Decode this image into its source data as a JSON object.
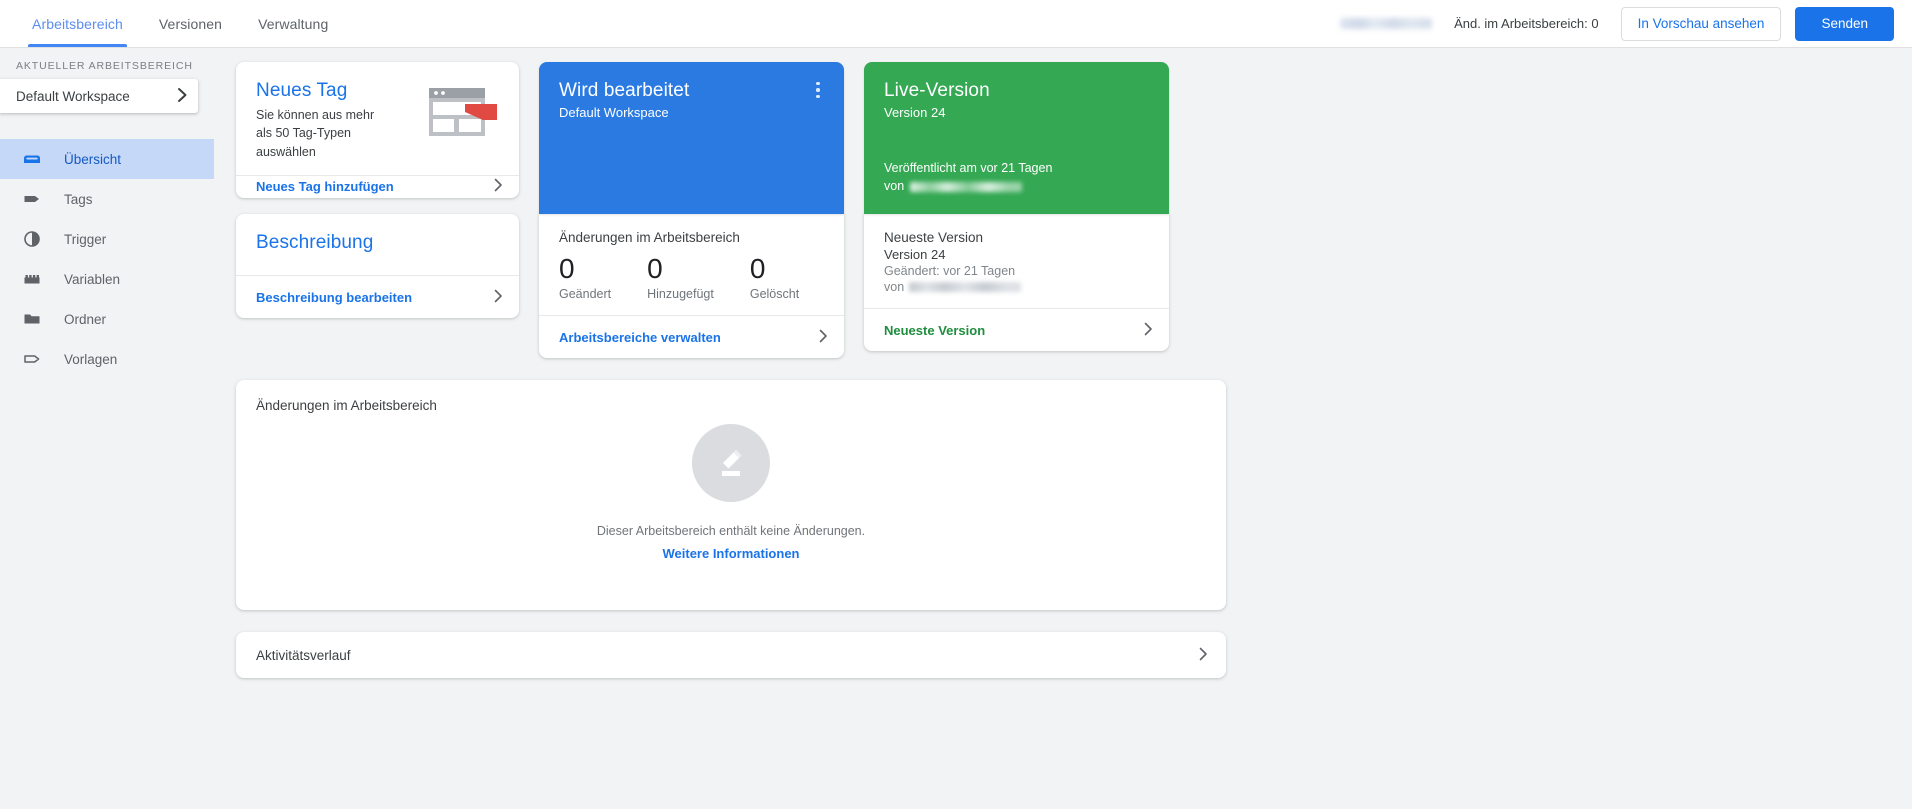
{
  "header": {
    "tabs": [
      {
        "label": "Arbeitsbereich",
        "active": true
      },
      {
        "label": "Versionen",
        "active": false
      },
      {
        "label": "Verwaltung",
        "active": false
      }
    ],
    "account_id_redacted": "",
    "changes_count_label": "Änd. im Arbeitsbereich: 0",
    "preview_button": "In Vorschau ansehen",
    "submit_button": "Senden"
  },
  "sidebar": {
    "caption": "AKTUELLER ARBEITSBEREICH",
    "workspace_selected": "Default Workspace",
    "items": [
      {
        "label": "Übersicht",
        "icon": "overview-icon",
        "active": true
      },
      {
        "label": "Tags",
        "icon": "tag-icon",
        "active": false
      },
      {
        "label": "Trigger",
        "icon": "trigger-icon",
        "active": false
      },
      {
        "label": "Variablen",
        "icon": "variables-icon",
        "active": false
      },
      {
        "label": "Ordner",
        "icon": "folder-icon",
        "active": false
      },
      {
        "label": "Vorlagen",
        "icon": "templates-icon",
        "active": false
      }
    ]
  },
  "new_tag_card": {
    "title": "Neues Tag",
    "subtitle": "Sie können aus mehr als 50 Tag-Typen auswählen",
    "footer_label": "Neues Tag hinzufügen"
  },
  "description_card": {
    "title": "Beschreibung",
    "footer_label": "Beschreibung bearbeiten"
  },
  "workspace_card": {
    "status_title": "Wird bearbeitet",
    "status_subtitle": "Default Workspace",
    "accent_color": "#2a7ae2",
    "changes_heading": "Änderungen im Arbeitsbereich",
    "counters": [
      {
        "value": "0",
        "label": "Geändert"
      },
      {
        "value": "0",
        "label": "Hinzugefügt"
      },
      {
        "value": "0",
        "label": "Gelöscht"
      }
    ],
    "footer_label": "Arbeitsbereiche verwalten"
  },
  "live_card": {
    "status_title": "Live-Version",
    "status_subtitle": "Version 24",
    "accent_color": "#34a853",
    "published_line": "Veröffentlicht am vor 21 Tagen",
    "von_label": "von",
    "latest_heading": "Neueste Version",
    "latest_version": "Version 24",
    "latest_modified": "Geändert: vor 21 Tagen",
    "footer_label": "Neueste Version"
  },
  "changes_panel": {
    "title": "Änderungen im Arbeitsbereich",
    "empty_message": "Dieser Arbeitsbereich enthält keine Änderungen.",
    "empty_link": "Weitere Informationen"
  },
  "activity": {
    "label": "Aktivitätsverlauf"
  },
  "icons": {
    "chevron_right": "›"
  }
}
